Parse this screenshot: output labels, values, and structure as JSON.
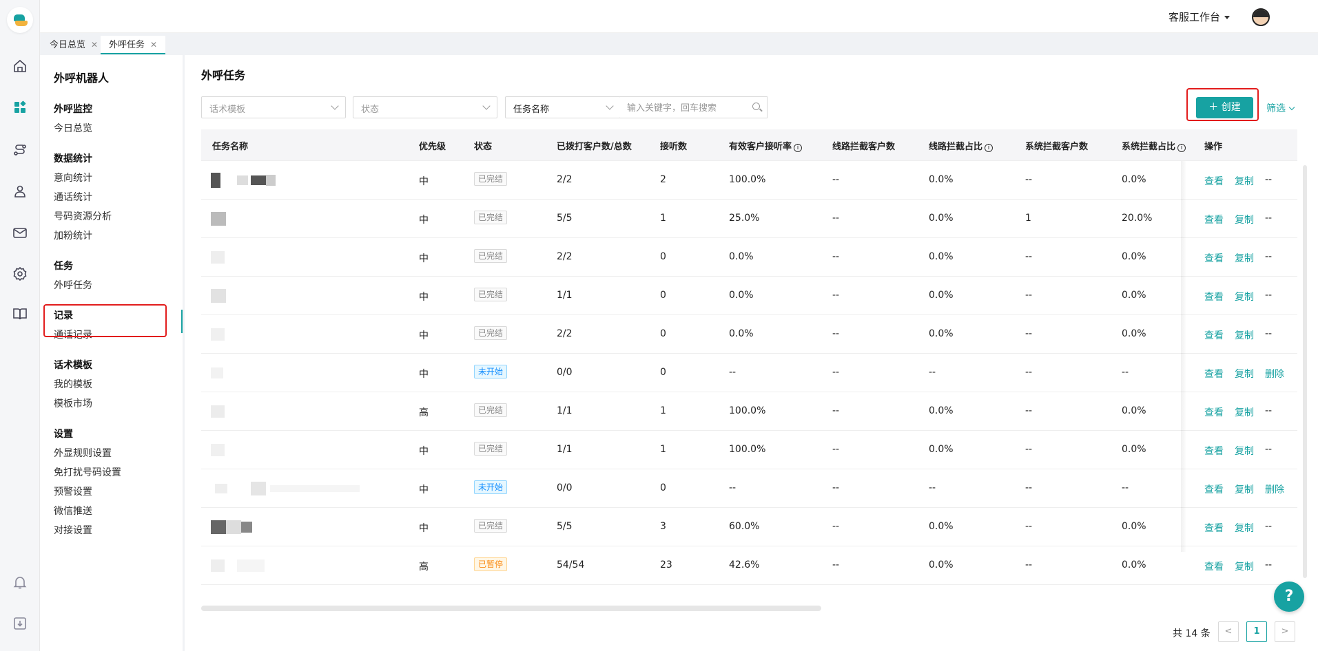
{
  "header": {
    "workspace": "客服工作台"
  },
  "tabs": [
    {
      "label": "今日总览"
    },
    {
      "label": "外呼任务"
    }
  ],
  "sidebar": {
    "title": "外呼机器人",
    "groups": [
      {
        "label": "外呼监控",
        "items": [
          "今日总览"
        ]
      },
      {
        "label": "数据统计",
        "items": [
          "意向统计",
          "通话统计",
          "号码资源分析",
          "加粉统计"
        ]
      },
      {
        "label": "任务",
        "items": [
          "外呼任务"
        ]
      },
      {
        "label": "记录",
        "items": [
          "通话记录"
        ]
      },
      {
        "label": "话术模板",
        "items": [
          "我的模板",
          "模板市场"
        ]
      },
      {
        "label": "设置",
        "items": [
          "外显规则设置",
          "免打扰号码设置",
          "预警设置",
          "微信推送",
          "对接设置"
        ]
      }
    ]
  },
  "page": {
    "title": "外呼任务",
    "filters": {
      "template_placeholder": "话术模板",
      "status_placeholder": "状态",
      "field_select": "任务名称",
      "search_placeholder": "输入关键字，回车搜索"
    },
    "create_label": "创建",
    "filter_label": "筛选"
  },
  "table": {
    "columns": [
      "任务名称",
      "优先级",
      "状态",
      "已拨打客户数/总数",
      "接听数",
      "有效客户接听率",
      "线路拦截客户数",
      "线路拦截占比",
      "系统拦截客户数",
      "系统拦截占比",
      "操作"
    ],
    "rows": [
      {
        "priority": "中",
        "status": "已完结",
        "dialed": "2/2",
        "answered": "2",
        "rate": "100.0%",
        "line_block": "--",
        "line_ratio": "0.0%",
        "sys_block": "--",
        "sys_ratio": "0.0%",
        "actions": [
          "查看",
          "复制",
          "--"
        ]
      },
      {
        "priority": "中",
        "status": "已完结",
        "dialed": "5/5",
        "answered": "1",
        "rate": "25.0%",
        "line_block": "--",
        "line_ratio": "0.0%",
        "sys_block": "1",
        "sys_ratio": "20.0%",
        "actions": [
          "查看",
          "复制",
          "--"
        ]
      },
      {
        "priority": "中",
        "status": "已完结",
        "dialed": "2/2",
        "answered": "0",
        "rate": "0.0%",
        "line_block": "--",
        "line_ratio": "0.0%",
        "sys_block": "--",
        "sys_ratio": "0.0%",
        "actions": [
          "查看",
          "复制",
          "--"
        ]
      },
      {
        "priority": "中",
        "status": "已完结",
        "dialed": "1/1",
        "answered": "0",
        "rate": "0.0%",
        "line_block": "--",
        "line_ratio": "0.0%",
        "sys_block": "--",
        "sys_ratio": "0.0%",
        "actions": [
          "查看",
          "复制",
          "--"
        ]
      },
      {
        "priority": "中",
        "status": "已完结",
        "dialed": "2/2",
        "answered": "0",
        "rate": "0.0%",
        "line_block": "--",
        "line_ratio": "0.0%",
        "sys_block": "--",
        "sys_ratio": "0.0%",
        "actions": [
          "查看",
          "复制",
          "--"
        ]
      },
      {
        "priority": "中",
        "status": "未开始",
        "dialed": "0/0",
        "answered": "0",
        "rate": "--",
        "line_block": "--",
        "line_ratio": "--",
        "sys_block": "--",
        "sys_ratio": "--",
        "actions": [
          "查看",
          "复制",
          "删除"
        ]
      },
      {
        "priority": "高",
        "status": "已完结",
        "dialed": "1/1",
        "answered": "1",
        "rate": "100.0%",
        "line_block": "--",
        "line_ratio": "0.0%",
        "sys_block": "--",
        "sys_ratio": "0.0%",
        "actions": [
          "查看",
          "复制",
          "--"
        ]
      },
      {
        "priority": "中",
        "status": "已完结",
        "dialed": "1/1",
        "answered": "1",
        "rate": "100.0%",
        "line_block": "--",
        "line_ratio": "0.0%",
        "sys_block": "--",
        "sys_ratio": "0.0%",
        "actions": [
          "查看",
          "复制",
          "--"
        ]
      },
      {
        "priority": "中",
        "status": "未开始",
        "dialed": "0/0",
        "answered": "0",
        "rate": "--",
        "line_block": "--",
        "line_ratio": "--",
        "sys_block": "--",
        "sys_ratio": "--",
        "actions": [
          "查看",
          "复制",
          "删除"
        ]
      },
      {
        "priority": "中",
        "status": "已完结",
        "dialed": "5/5",
        "answered": "3",
        "rate": "60.0%",
        "line_block": "--",
        "line_ratio": "0.0%",
        "sys_block": "--",
        "sys_ratio": "0.0%",
        "actions": [
          "查看",
          "复制",
          "--"
        ]
      },
      {
        "priority": "高",
        "status": "已暂停",
        "dialed": "54/54",
        "answered": "23",
        "rate": "42.6%",
        "line_block": "--",
        "line_ratio": "0.0%",
        "sys_block": "--",
        "sys_ratio": "0.0%",
        "actions": [
          "查看",
          "复制",
          "--"
        ]
      }
    ]
  },
  "pagination": {
    "total": "共 14 条",
    "current": "1",
    "prev": "<",
    "next": ">"
  },
  "colors": {
    "accent": "#17a2a2",
    "highlight": "#e21c1c"
  },
  "rail_icons": [
    "home-icon",
    "apps-icon",
    "route-icon",
    "users-icon",
    "mail-icon",
    "settings-icon",
    "book-icon",
    "bell-icon",
    "download-icon"
  ],
  "help_icon": "?"
}
